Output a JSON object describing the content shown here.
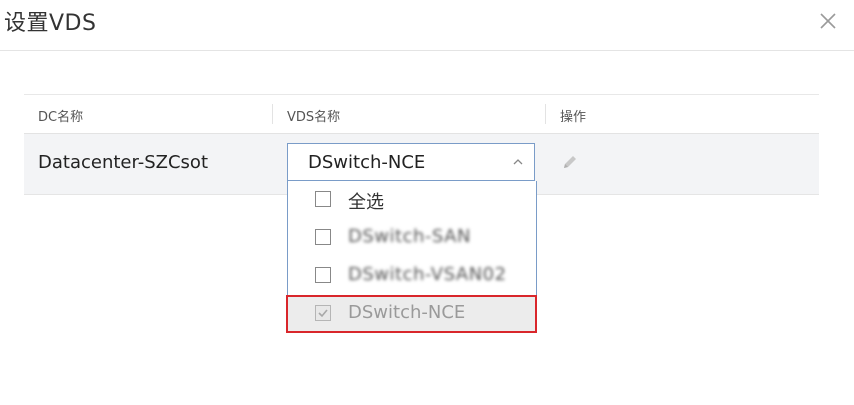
{
  "dialog": {
    "title": "设置VDS",
    "close_icon": "close-icon"
  },
  "table": {
    "columns": [
      "DC名称",
      "VDS名称",
      "操作"
    ],
    "rows": [
      {
        "dc_name": "Datacenter-SZCsot",
        "vds_selected": "DSwitch-NCE",
        "action_icon": "edit-icon"
      }
    ]
  },
  "dropdown": {
    "expanded": true,
    "chevron_icon": "chevron-up-icon",
    "options": [
      {
        "label": "全选",
        "checked": false,
        "disabled": false
      },
      {
        "label": "DSwitch-SAN",
        "checked": false,
        "disabled": false,
        "obscured": true
      },
      {
        "label": "DSwitch-VSAN02",
        "checked": false,
        "disabled": false,
        "obscured": true
      },
      {
        "label": "DSwitch-NCE",
        "checked": true,
        "disabled": true,
        "highlighted": true
      }
    ]
  },
  "colors": {
    "highlight_border": "#d9262b",
    "select_border": "#7a9cc8",
    "row_background": "#f3f4f6"
  }
}
